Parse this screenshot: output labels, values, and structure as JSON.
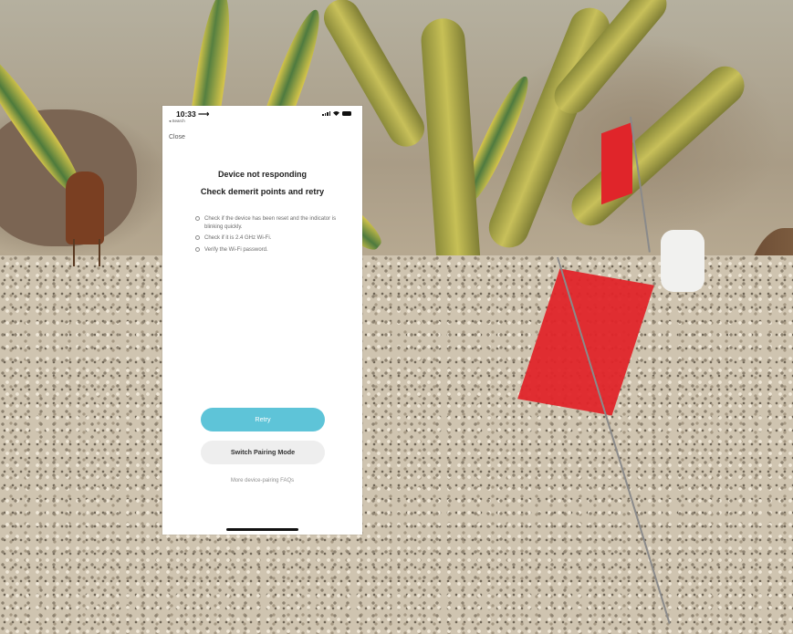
{
  "status_bar": {
    "time": "10:33 ⟶",
    "back_label": "◂ Search",
    "icons": [
      "signal-icon",
      "wifi-icon",
      "battery-icon"
    ]
  },
  "nav": {
    "close_label": "Close"
  },
  "content": {
    "title_line1": "Device not responding",
    "title_line2": "Check demerit points and retry",
    "tips": [
      "Check if the device has been reset and the indicator is blinking quickly.",
      "Check if it is 2.4 GHz Wi-Fi.",
      "Verify the Wi-Fi password."
    ]
  },
  "actions": {
    "retry_label": "Retry",
    "switch_label": "Switch Pairing Mode",
    "faq_label": "More device-pairing FAQs"
  },
  "colors": {
    "accent": "#5ec4d8",
    "secondary_button": "#eeeeee",
    "flag": "#e0252a"
  }
}
